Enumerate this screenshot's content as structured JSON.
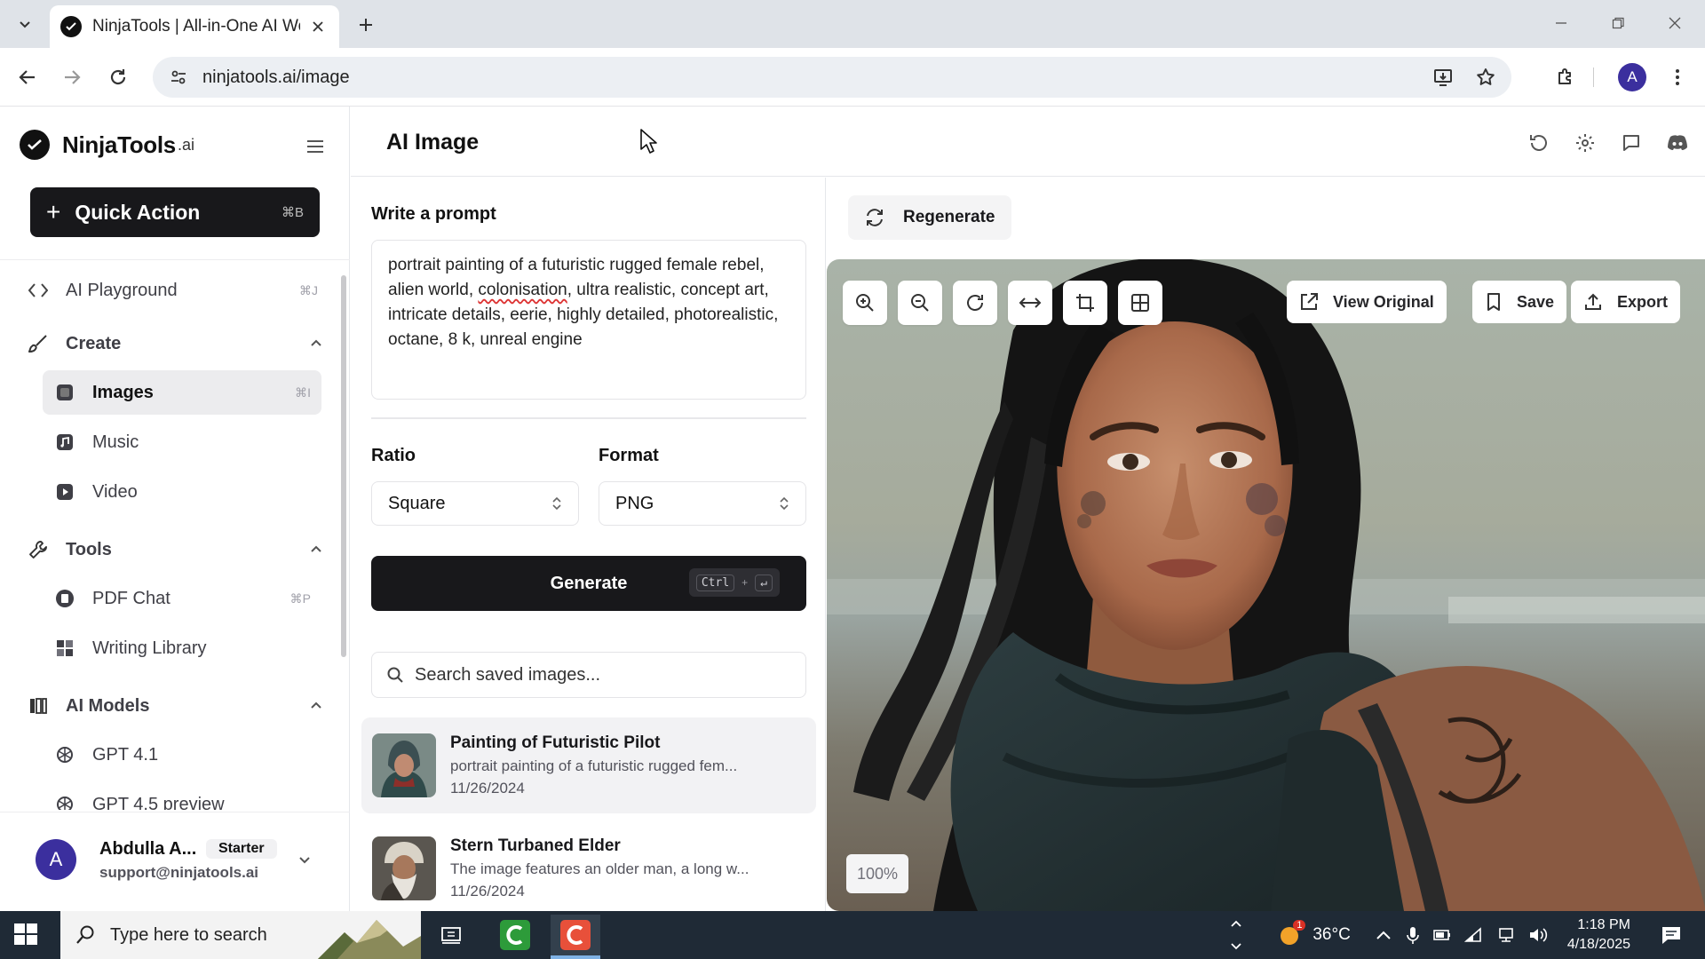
{
  "browser": {
    "tab_title": "NinjaTools | All-in-One AI Work",
    "url": "ninjatools.ai/image",
    "profile_initial": "A"
  },
  "brand": {
    "name": "NinjaTools",
    "suffix": ".ai"
  },
  "sidebar": {
    "quick_action": {
      "label": "Quick Action",
      "shortcut": "⌘B"
    },
    "playground": {
      "label": "AI Playground",
      "shortcut": "⌘J"
    },
    "create": {
      "label": "Create",
      "items": [
        {
          "label": "Images",
          "shortcut": "⌘I"
        },
        {
          "label": "Music"
        },
        {
          "label": "Video"
        }
      ]
    },
    "tools": {
      "label": "Tools",
      "items": [
        {
          "label": "PDF Chat",
          "shortcut": "⌘P"
        },
        {
          "label": "Writing Library"
        }
      ]
    },
    "models": {
      "label": "AI Models",
      "items": [
        {
          "label": "GPT 4.1"
        },
        {
          "label": "GPT 4.5 preview"
        }
      ]
    },
    "user": {
      "initial": "A",
      "name": "Abdulla A...",
      "plan": "Starter",
      "email": "support@ninjatools.ai"
    }
  },
  "header": {
    "title": "AI Image"
  },
  "prompt": {
    "label": "Write a prompt",
    "text_before": "portrait painting of a futuristic rugged female rebel, alien world, ",
    "text_misspelled": "colonisation",
    "text_after": ", ultra realistic, concept art, intricate details, eerie, highly detailed, photorealistic, octane, 8 k, unreal engine"
  },
  "ratio": {
    "label": "Ratio",
    "value": "Square"
  },
  "format": {
    "label": "Format",
    "value": "PNG"
  },
  "generate": {
    "label": "Generate",
    "kbd1": "Ctrl",
    "kbd_plus": "+",
    "kbd2": "↵"
  },
  "search": {
    "placeholder": "Search saved images..."
  },
  "saved_images": [
    {
      "title": "Painting of Futuristic Pilot",
      "desc": "portrait painting of a futuristic rugged fem...",
      "date": "11/26/2024"
    },
    {
      "title": "Stern Turbaned Elder",
      "desc": "The image features an older man, a long w...",
      "date": "11/26/2024"
    }
  ],
  "viewer": {
    "regenerate_label": "Regenerate",
    "view_original_label": "View Original",
    "save_label": "Save",
    "export_label": "Export",
    "zoom": "100%"
  },
  "taskbar": {
    "search_placeholder": "Type here to search",
    "temperature": "36°C",
    "weather_badge": "1",
    "time": "1:18 PM",
    "date": "4/18/2025"
  }
}
